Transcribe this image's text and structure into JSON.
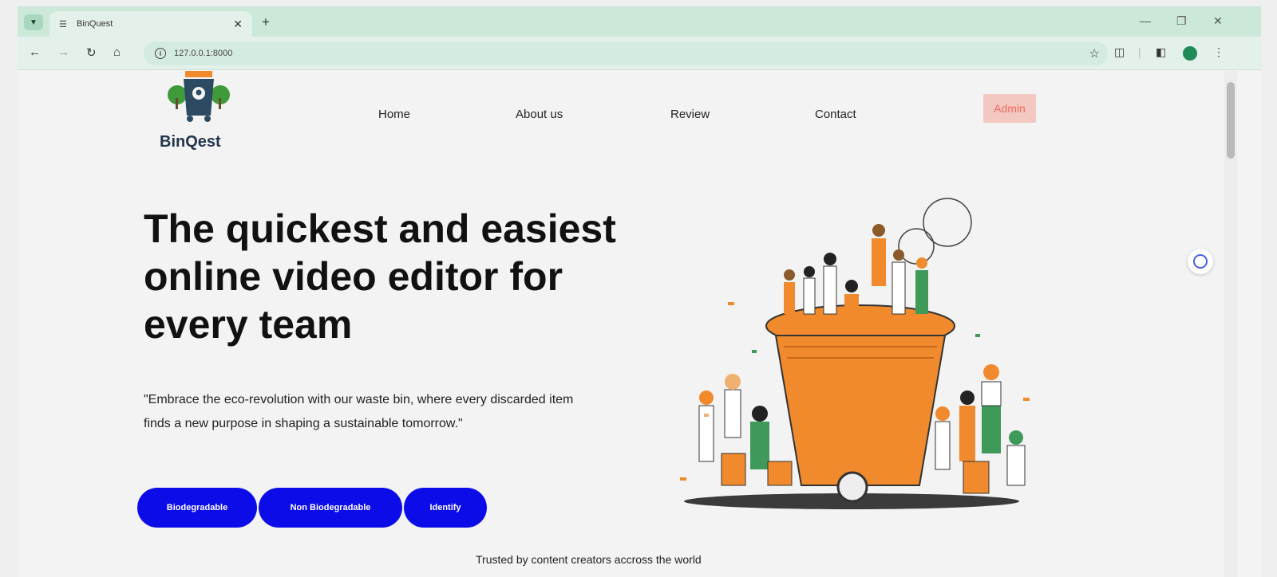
{
  "browser": {
    "tab_title": "BinQuest",
    "url": "127.0.0.1:8000",
    "icons": [
      "tab-search-icon",
      "favicon-icon",
      "close-tab-icon",
      "new-tab-icon",
      "back-icon",
      "forward-icon",
      "reload-icon",
      "home-icon",
      "site-info-icon",
      "bookmark-star-icon",
      "extensions-icon",
      "side-panel-icon",
      "profile-icon",
      "menu-icon"
    ]
  },
  "header": {
    "logo_text": "BinQest",
    "nav": [
      "Home",
      "About us",
      "Review",
      "Contact"
    ],
    "admin_label": "Admin"
  },
  "hero": {
    "title": "The quickest and easiest online video editor for every team",
    "description": "\"Embrace the eco-revolution with our waste bin, where every discarded item finds a new purpose in shaping a sustainable tomorrow.\"",
    "buttons": [
      "Biodegradable",
      "Non Biodegradable",
      "Identify"
    ],
    "trusted_text": "Trusted by content creators accross the world"
  },
  "colors": {
    "accent_button": "#0c0ce8",
    "admin_bg": "#f2c8c1",
    "admin_text": "#f26b5b",
    "bin_orange": "#f08a2c",
    "chrome_green": "#cbe8d9"
  }
}
